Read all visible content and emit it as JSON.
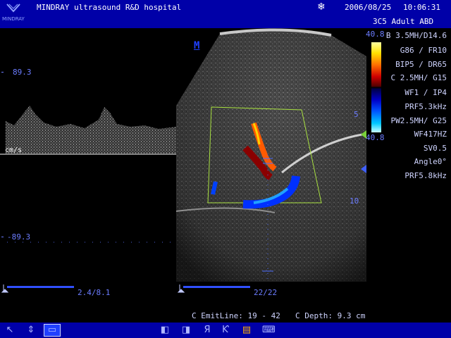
{
  "header": {
    "logo_text": "MINDRAY",
    "hospital_name": "MINDRAY ultrasound R&D hospital",
    "date": "2006/08/25",
    "time": "10:06:31",
    "probe_exam": "3C5 Adult ABD",
    "freeze_icon": "snowflake-icon"
  },
  "doppler": {
    "scale_top": "89.3",
    "scale_bottom": "-89.3",
    "unit": "cm/s",
    "time_readout": "2.4/8.1"
  },
  "image": {
    "orientation_mark": "M",
    "depth_marks": [
      "5",
      "10"
    ],
    "frame_counter": "22/22"
  },
  "colorbar": {
    "top": "40.8",
    "bottom": "40.8"
  },
  "params": [
    "B 3.5MH/D14.6",
    "G86 / FR10",
    "BIP5 / DR65",
    "C 2.5MH/ G15",
    "WF1 /  IP4",
    "PRF5.3kHz",
    "PW2.5MH/ G25",
    "WF417HZ",
    "SV0.5",
    "Angle0°",
    "PRF5.8kHz"
  ],
  "status": {
    "emit_line": "C EmitLine: 19 - 42",
    "depth": "C Depth: 9.3 cm"
  },
  "toolbar": {
    "icons": [
      "pointer-icon",
      "move-icon",
      "window-icon",
      "left-right-icon",
      "up-down-icon",
      "flip-vertical-icon",
      "flip-horizontal-icon",
      "color-map-icon",
      "keyboard-icon"
    ]
  },
  "colors": {
    "bar_blue": "#0000a8",
    "label_blue": "#6b7cff",
    "roi_green": "#a8e040"
  }
}
